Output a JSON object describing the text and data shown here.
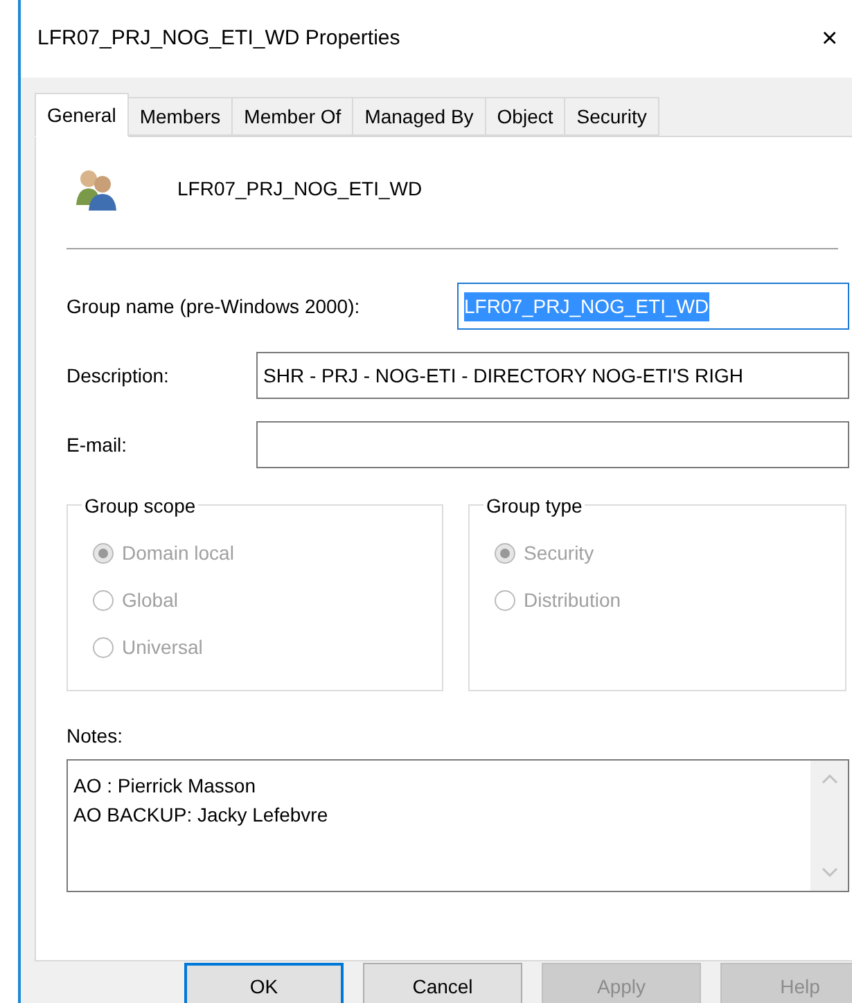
{
  "window": {
    "title": "LFR07_PRJ_NOG_ETI_WD Properties",
    "close": "×"
  },
  "tabs": [
    {
      "label": "General",
      "selected": true
    },
    {
      "label": "Members",
      "selected": false
    },
    {
      "label": "Member Of",
      "selected": false
    },
    {
      "label": "Managed By",
      "selected": false
    },
    {
      "label": "Object",
      "selected": false
    },
    {
      "label": "Security",
      "selected": false
    }
  ],
  "header": {
    "name": "LFR07_PRJ_NOG_ETI_WD"
  },
  "fields": [
    {
      "label": "Group name (pre-Windows 2000):",
      "value": "LFR07_PRJ_NOG_ETI_WD",
      "selected": true
    },
    {
      "label": "Description:",
      "value": "SHR - PRJ - NOG-ETI - DIRECTORY NOG-ETI'S RIGH",
      "selected": false
    },
    {
      "label": "E-mail:",
      "selected": false
    }
  ],
  "groups": [
    {
      "title": "Group scope",
      "options": [
        {
          "label": "Domain local",
          "selected": true,
          "disabled": true
        },
        {
          "label": "Global",
          "selected": false,
          "disabled": true
        },
        {
          "label": "Universal",
          "selected": false,
          "disabled": true
        }
      ]
    },
    {
      "title": "Group type",
      "options": [
        {
          "label": "Security",
          "selected": true,
          "disabled": true
        },
        {
          "label": "Distribution",
          "selected": false,
          "disabled": true
        }
      ]
    }
  ],
  "notes": {
    "label": "Notes:",
    "lines": [
      "AO : Pierrick Masson",
      "AO BACKUP: Jacky Lefebvre"
    ]
  },
  "buttons": [
    {
      "label": "OK",
      "default": true,
      "disabled": false
    },
    {
      "label": "Cancel",
      "default": false,
      "disabled": false
    },
    {
      "label": "Apply",
      "default": false,
      "disabled": true
    },
    {
      "label": "Help",
      "default": false,
      "disabled": true
    }
  ]
}
